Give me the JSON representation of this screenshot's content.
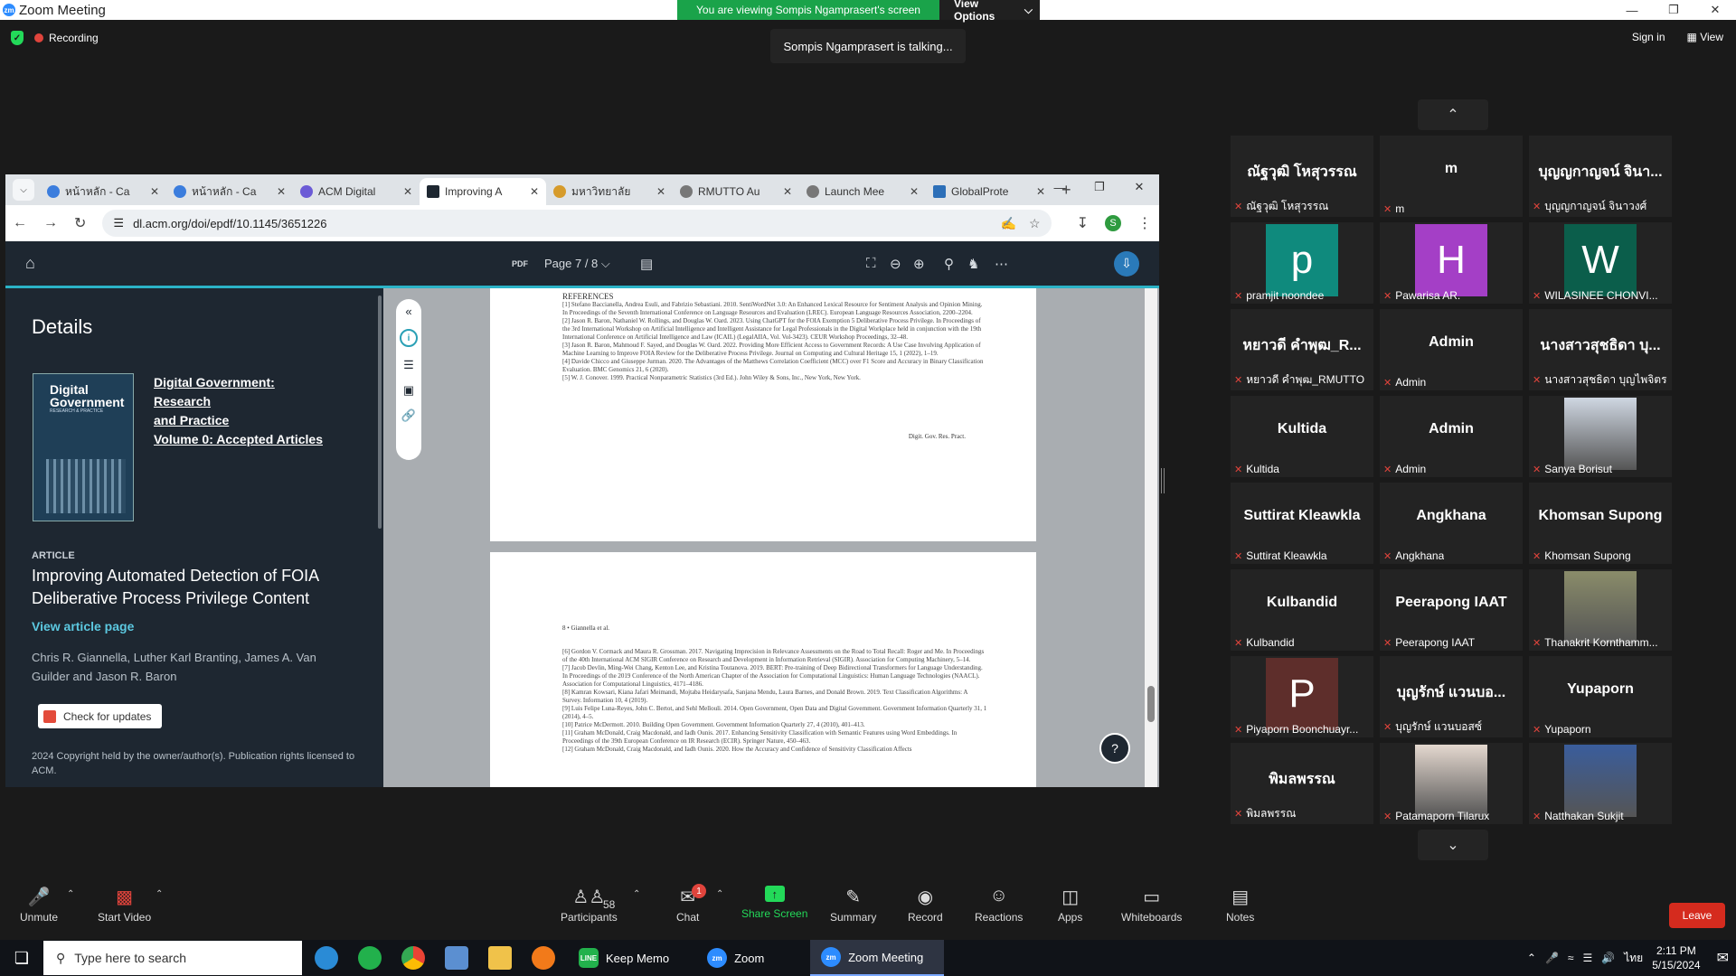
{
  "window": {
    "title": "Zoom Meeting",
    "banner": "You are viewing Sompis Ngamprasert's screen",
    "view_options": "View Options",
    "recording": "Recording",
    "talking": "Sompis Ngamprasert is talking...",
    "sign_in": "Sign in",
    "view": "View"
  },
  "browser": {
    "tabs": [
      {
        "label": "หน้าหลัก - Ca"
      },
      {
        "label": "หน้าหลัก - Ca"
      },
      {
        "label": "ACM Digital"
      },
      {
        "label": "Improving A"
      },
      {
        "label": "มหาวิทยาลัย"
      },
      {
        "label": "RMUTTO Au"
      },
      {
        "label": "Launch Mee"
      },
      {
        "label": "GlobalProte"
      }
    ],
    "url": "dl.acm.org/doi/epdf/10.1145/3651226",
    "profile_initial": "S"
  },
  "pdf": {
    "label": "PDF",
    "page_selector": "Page 7 / 8",
    "details_heading": "Details",
    "cover_title": "Digital Government",
    "cover_subtitle": "RESEARCH & PRACTICE",
    "journal_link_line1": "Digital Government: Research",
    "journal_link_line2": "and Practice",
    "journal_link_line3": "Volume 0: Accepted Articles",
    "article_label": "ARTICLE",
    "article_title": "Improving Automated Detection of FOIA Deliberative Process Privilege Content",
    "view_article": "View article page",
    "authors": "Chris R. Giannella, Luther Karl Branting, James A. Van Guilder and Jason R. Baron",
    "check_updates": "Check for updates",
    "copyright": "2024 Copyright held by the owner/author(s). Publication rights licensed to ACM.",
    "refs_heading": "REFERENCES",
    "page1_refs": [
      "[1] Stefano Baccianella, Andrea Esuli, and Fabrizio Sebastiani. 2010. SentiWordNet 3.0: An Enhanced Lexical Resource for Sentiment Analysis and Opinion Mining. In Proceedings of the Seventh International Conference on Language Resources and Evaluation (LREC). European Language Resources Association, 2200–2204.",
      "[2] Jason R. Baron, Nathaniel W. Rollings, and Douglas W. Oard. 2023. Using ChatGPT for the FOIA Exemption 5 Deliberative Process Privilege. In Proceedings of the 3rd International Workshop on Artificial Intelligence and Intelligent Assistance for Legal Professionals in the Digital Workplace held in conjunction with the 19th International Conference on Artificial Intelligence and Law (ICAIL) (LegalAIIA, Vol. Vol-3423). CEUR Workshop Proceedings, 32–48.",
      "[3] Jason R. Baron, Mahmoud F. Sayed, and Douglas W. Oard. 2022. Providing More Efficient Access to Government Records: A Use Case Involving Application of Machine Learning to Improve FOIA Review for the Deliberative Process Privilege. Journal on Computing and Cultural Heritage 15, 1 (2022), 1–19.",
      "[4] Davide Chicco and Giuseppe Jurman. 2020. The Advantages of the Matthews Correlation Coefficient (MCC) over F1 Score and Accuracy in Binary Classification Evaluation. BMC Genomics 21, 6 (2020).",
      "[5] W. J. Conover. 1999. Practical Nonparametric Statistics (3rd Ed.). John Wiley & Sons, Inc., New York, New York."
    ],
    "page1_footer": "Digit. Gov. Res. Pract.",
    "page2_header": "8 • Giannella et al.",
    "page2_refs": [
      "[6] Gordon V. Cormack and Maura R. Grossman. 2017. Navigating Imprecision in Relevance Assessments on the Road to Total Recall: Roger and Me. In Proceedings of the 40th International ACM SIGIR Conference on Research and Development in Information Retrieval (SIGIR). Association for Computing Machinery, 5–14.",
      "[7] Jacob Devlin, Ming-Wei Chang, Kenton Lee, and Kristina Toutanova. 2019. BERT: Pre-training of Deep Bidirectional Transformers for Language Understanding. In Proceedings of the 2019 Conference of the North American Chapter of the Association for Computational Linguistics: Human Language Technologies (NAACL). Association for Computational Linguistics, 4171–4186.",
      "[8] Kamran Kowsari, Kiana Jafari Meimandi, Mojtaba Heidarysafa, Sanjana Mendu, Laura Barnes, and Donald Brown. 2019. Text Classification Algorithms: A Survey. Information 10, 4 (2019).",
      "[9] Luis Felipe Luna-Reyes, John C. Bertot, and Sehl Mellouli. 2014. Open Government, Open Data and Digital Government. Government Information Quarterly 31, 1 (2014), 4–5.",
      "[10] Patrice McDermott. 2010. Building Open Government. Government Information Quarterly 27, 4 (2010), 401–413.",
      "[11] Graham McDonald, Craig Macdonald, and Iadh Ounis. 2017. Enhancing Sensitivity Classification with Semantic Features using Word Embeddings. In Proceedings of the 39th European Conference on IR Research (ECIR). Springer Nature, 450–463.",
      "[12] Graham McDonald, Craig Macdonald, and Iadh Ounis. 2020. How the Accuracy and Confidence of Sensitivity Classification Affects"
    ]
  },
  "gallery": {
    "tiles": [
      {
        "big": "ณัฐวุฒิ โหสุวรรณ",
        "name": "ณัฐวุฒิ โหสุวรรณ",
        "avatar": "",
        "color": ""
      },
      {
        "big": "m",
        "name": "m",
        "avatar": "",
        "color": ""
      },
      {
        "big": "บุญญกาญจน์ จินา...",
        "name": "บุญญกาญจน์ จินาวงศ์",
        "avatar": "",
        "color": ""
      },
      {
        "big": "",
        "name": "pramjit noondee",
        "avatar": "p",
        "color": "#0f8a7d"
      },
      {
        "big": "",
        "name": "Pawarisa AR.",
        "avatar": "H",
        "color": "#a43fc6"
      },
      {
        "big": "",
        "name": "WILASINEE CHONVI...",
        "avatar": "W",
        "color": "#0b5e4b"
      },
      {
        "big": "หยาวดี คำพุฒ_R...",
        "name": "หยาวดี คำพุฒ_RMUTTO",
        "avatar": "",
        "color": ""
      },
      {
        "big": "Admin",
        "name": "Admin",
        "avatar": "",
        "color": ""
      },
      {
        "big": "นางสาวสุชธิดา บุ...",
        "name": "นางสาวสุชธิดา บุญไพจิตร",
        "avatar": "",
        "color": ""
      },
      {
        "big": "Kultida",
        "name": "Kultida",
        "avatar": "",
        "color": ""
      },
      {
        "big": "Admin",
        "name": "Admin",
        "avatar": "",
        "color": ""
      },
      {
        "big": "",
        "name": "Sanya Borisut",
        "avatar": "photo",
        "color": "#cfd7e2"
      },
      {
        "big": "Suttirat Kleawkla",
        "name": "Suttirat Kleawkla",
        "avatar": "",
        "color": ""
      },
      {
        "big": "Angkhana",
        "name": "Angkhana",
        "avatar": "",
        "color": ""
      },
      {
        "big": "Khomsan Supong",
        "name": "Khomsan Supong",
        "avatar": "",
        "color": ""
      },
      {
        "big": "Kulbandid",
        "name": "Kulbandid",
        "avatar": "",
        "color": ""
      },
      {
        "big": "Peerapong IAAT",
        "name": "Peerapong IAAT",
        "avatar": "",
        "color": ""
      },
      {
        "big": "",
        "name": "Thanakrit Kornthamm...",
        "avatar": "photo",
        "color": "#8a8c6a"
      },
      {
        "big": "",
        "name": "Piyaporn Boonchuayr...",
        "avatar": "P",
        "color": "#5e2e2b"
      },
      {
        "big": "บุญรักษ์ แวนบอ...",
        "name": "บุญรักษ์ แวนบอสซ์",
        "avatar": "",
        "color": ""
      },
      {
        "big": "Yupaporn",
        "name": "Yupaporn",
        "avatar": "",
        "color": ""
      },
      {
        "big": "พิมลพรรณ",
        "name": "พิมลพรรณ",
        "avatar": "",
        "color": ""
      },
      {
        "big": "",
        "name": "Patamaporn Tilarux",
        "avatar": "photo",
        "color": "#e4d8cf"
      },
      {
        "big": "",
        "name": "Natthakan Sukjit",
        "avatar": "photo",
        "color": "#3a5d9c"
      }
    ]
  },
  "toolbar": {
    "unmute": "Unmute",
    "start_video": "Start Video",
    "participants": "Participants",
    "participants_count": "58",
    "chat": "Chat",
    "chat_badge": "1",
    "share_screen": "Share Screen",
    "summary": "Summary",
    "record": "Record",
    "reactions": "Reactions",
    "apps": "Apps",
    "whiteboards": "Whiteboards",
    "notes": "Notes",
    "leave": "Leave"
  },
  "taskbar": {
    "search_placeholder": "Type here to search",
    "apps": [
      {
        "label": "Keep Memo"
      },
      {
        "label": "Zoom"
      },
      {
        "label": "Zoom Meeting"
      }
    ],
    "lang": "ไทย",
    "time": "2:11 PM",
    "date": "5/15/2024"
  }
}
